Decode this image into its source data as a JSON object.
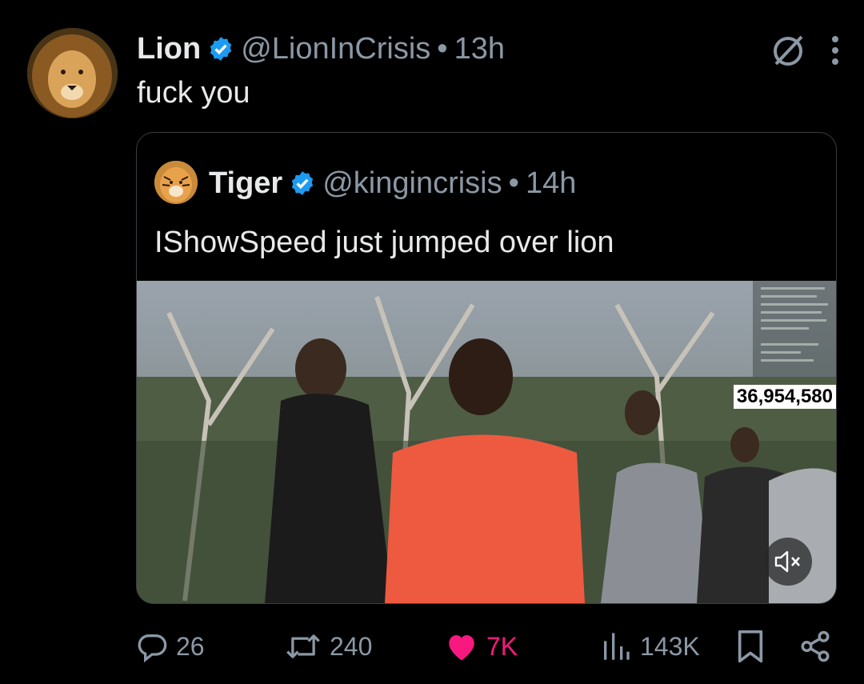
{
  "post": {
    "name": "Lion",
    "handle": "@LionInCrisis",
    "separator": "•",
    "time": "13h",
    "text": "fuck you"
  },
  "quote": {
    "name": "Tiger",
    "handle": "@kingincrisis",
    "separator": "•",
    "time": "14h",
    "text": "IShowSpeed just jumped over lion",
    "media": {
      "viewer_counter": "36,954,580"
    }
  },
  "actions": {
    "replies": "26",
    "reposts": "240",
    "likes": "7K",
    "views": "143K"
  },
  "colors": {
    "background": "#000000",
    "text": "#e7e9ea",
    "muted": "#8b98a5",
    "verified": "#1d9bf0",
    "like": "#f91880",
    "border": "#3a3d41"
  },
  "icons": [
    "verified-badge-icon",
    "grok-icon",
    "more-icon",
    "mute-icon",
    "reply-icon",
    "repost-icon",
    "heart-icon",
    "views-icon",
    "bookmark-icon",
    "share-icon"
  ]
}
